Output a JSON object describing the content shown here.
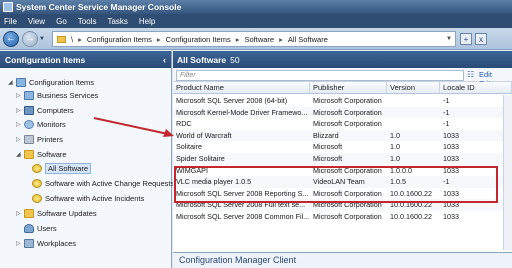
{
  "window": {
    "title": "System Center Service Manager Console"
  },
  "menu": [
    "File",
    "View",
    "Go",
    "Tools",
    "Tasks",
    "Help"
  ],
  "breadcrumb": [
    "\\",
    "Configuration Items",
    "Configuration Items",
    "Software",
    "All Software"
  ],
  "nav_right": [
    "+",
    "x"
  ],
  "left_pane": {
    "title": "Configuration Items",
    "items": [
      {
        "label": "Configuration Items",
        "icon": "ci-icon",
        "expanded": true
      },
      {
        "label": "Business Services",
        "icon": "ci-icon"
      },
      {
        "label": "Computers",
        "icon": "computer-icon"
      },
      {
        "label": "Monitors",
        "icon": "monitor-icon"
      },
      {
        "label": "Printers",
        "icon": "printer-icon"
      },
      {
        "label": "Software",
        "icon": "folder-icon",
        "expanded": true
      },
      {
        "label": "All Software",
        "icon": "software-icon",
        "selected": true
      },
      {
        "label": "Software with Active Change Requests",
        "icon": "software-icon"
      },
      {
        "label": "Software with Active Incidents",
        "icon": "software-icon"
      },
      {
        "label": "Software Updates",
        "icon": "folder-icon"
      },
      {
        "label": "Users",
        "icon": "user-icon"
      },
      {
        "label": "Workplaces",
        "icon": "workplace-icon"
      }
    ]
  },
  "right_pane": {
    "title": "All Software",
    "count": "50",
    "filter_placeholder": "Filter",
    "edit_criteria": "Edit Criter",
    "columns": [
      "Product Name",
      "Publisher",
      "Version",
      "Locale ID"
    ],
    "rows": [
      [
        "Microsoft SQL Server 2008 (64-bit)",
        "Microsoft Corporation",
        "",
        "-1"
      ],
      [
        "Microsoft Kernel-Mode Driver Framewo...",
        "Microsoft Corporation",
        "",
        "-1"
      ],
      [
        "RDC",
        "Microsoft Corporation",
        "",
        "-1"
      ],
      [
        "World of Warcraft",
        "Blizzard",
        "1.0",
        "1033"
      ],
      [
        "Solitaire",
        "Microsoft",
        "1.0",
        "1033"
      ],
      [
        "Spider Solitaire",
        "Microsoft",
        "1.0",
        "1033"
      ],
      [
        "WIMGAPI",
        "Microsoft Corporation",
        "1.0.0.0",
        "1033"
      ],
      [
        "VLC media player 1.0.5",
        "VideoLAN Team",
        "1.0.5",
        "-1"
      ],
      [
        "Microsoft SQL Server 2008 Reporting S...",
        "Microsoft Corporation",
        "10.0.1600.22",
        "1033"
      ],
      [
        "Microsoft SQL Server 2008 Full text se...",
        "Microsoft Corporation",
        "10.0.1600.22",
        "1033"
      ],
      [
        "Microsoft SQL Server 2008 Common Fil...",
        "Microsoft Corporation",
        "10.0.1600.22",
        "1033"
      ]
    ]
  },
  "bottom_pane": {
    "title": "Configuration Manager Client"
  },
  "colors": {
    "annotation": "#c1272d",
    "header": "#2a4b77"
  }
}
